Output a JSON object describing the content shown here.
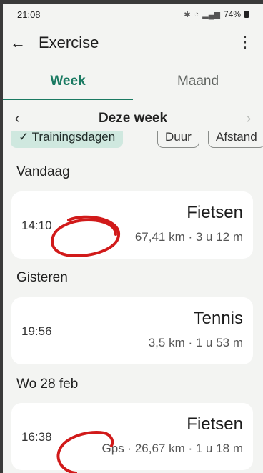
{
  "status": {
    "time": "21:08",
    "battery": "74%"
  },
  "app": {
    "title": "Exercise"
  },
  "tabs": [
    {
      "label": "Week"
    },
    {
      "label": "Maand"
    }
  ],
  "period": {
    "label": "Deze week"
  },
  "filters": {
    "training": "✓ Trainingsdagen",
    "duration": "Duur",
    "distance": "Afstand"
  },
  "days": [
    {
      "label": "Vandaag",
      "entries": [
        {
          "time": "14:10",
          "activity": "Fietsen",
          "stats": "67,41 km · 3 u 12 m"
        }
      ]
    },
    {
      "label": "Gisteren",
      "entries": [
        {
          "time": "19:56",
          "activity": "Tennis",
          "stats": "3,5 km · 1 u 53 m"
        }
      ]
    },
    {
      "label": "Wo 28 feb",
      "entries": [
        {
          "time": "16:38",
          "activity": "Fietsen",
          "stats": "Gps · 26,67 km · 1 u 18 m"
        }
      ]
    }
  ],
  "colors": {
    "accent": "#1a7a62",
    "chip_bg": "#cfe8df",
    "annotation": "#d11a1a"
  }
}
